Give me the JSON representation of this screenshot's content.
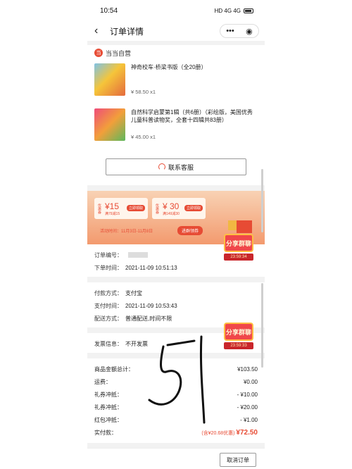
{
  "status": {
    "time": "10:54",
    "icons": "HD 4G 4G"
  },
  "nav": {
    "back_icon": "‹",
    "title": "订单详情",
    "menu_icon": "•••",
    "close_icon": "◉"
  },
  "shop": {
    "name": "当当自营"
  },
  "products": [
    {
      "title": "神奇校车·桥梁书版（全20册）",
      "price": "¥ 58.50 x1"
    },
    {
      "title": "自然科学启蒙第1辑（共6册）（彩绘版，美国优秀儿童科普读物奖，全套十四辑共83册）",
      "price": "¥ 45.00 x1"
    }
  ],
  "service_label": "联系客服",
  "banner": {
    "coupon1_tag": "优惠券",
    "coupon1_value": "¥15",
    "coupon1_sub": "满79减15",
    "coupon1_btn": "立即领取",
    "coupon2_tag": "优惠券",
    "coupon2_value": "¥ 30",
    "coupon2_sub": "满149减30",
    "coupon2_btn": "立即领取",
    "activity": "活动时间：11月3日-11月8日",
    "go": "进群领券"
  },
  "order": {
    "no_label": "订单编号：",
    "time_label": "下单时间：",
    "time": "2021-11-09 10:51:13",
    "pay_method_label": "付款方式：",
    "pay_method": "支付宝",
    "pay_time_label": "支付时间：",
    "pay_time": "2021-11-09 10:53:43",
    "delivery_label": "配送方式：",
    "delivery": "普通配送,时间不限",
    "invoice_label": "发票信息：",
    "invoice": "不开发票"
  },
  "summary": [
    {
      "label": "商品金额总计：",
      "value": "¥103.50"
    },
    {
      "label": "运费：",
      "value": "¥0.00"
    },
    {
      "label": "礼券冲抵：",
      "value": "- ¥10.00"
    },
    {
      "label": "礼券冲抵：",
      "value": "- ¥20.00"
    },
    {
      "label": "红包冲抵：",
      "value": "- ¥1.00"
    }
  ],
  "paid": {
    "label": "实付款：",
    "note": "(含¥20.68优惠)",
    "value": "¥72.50"
  },
  "share": {
    "label": "分享群聊",
    "timer1": "23:59:34",
    "timer2": "23:59:33"
  },
  "cancel_label": "取消订单",
  "handwriting": "51"
}
